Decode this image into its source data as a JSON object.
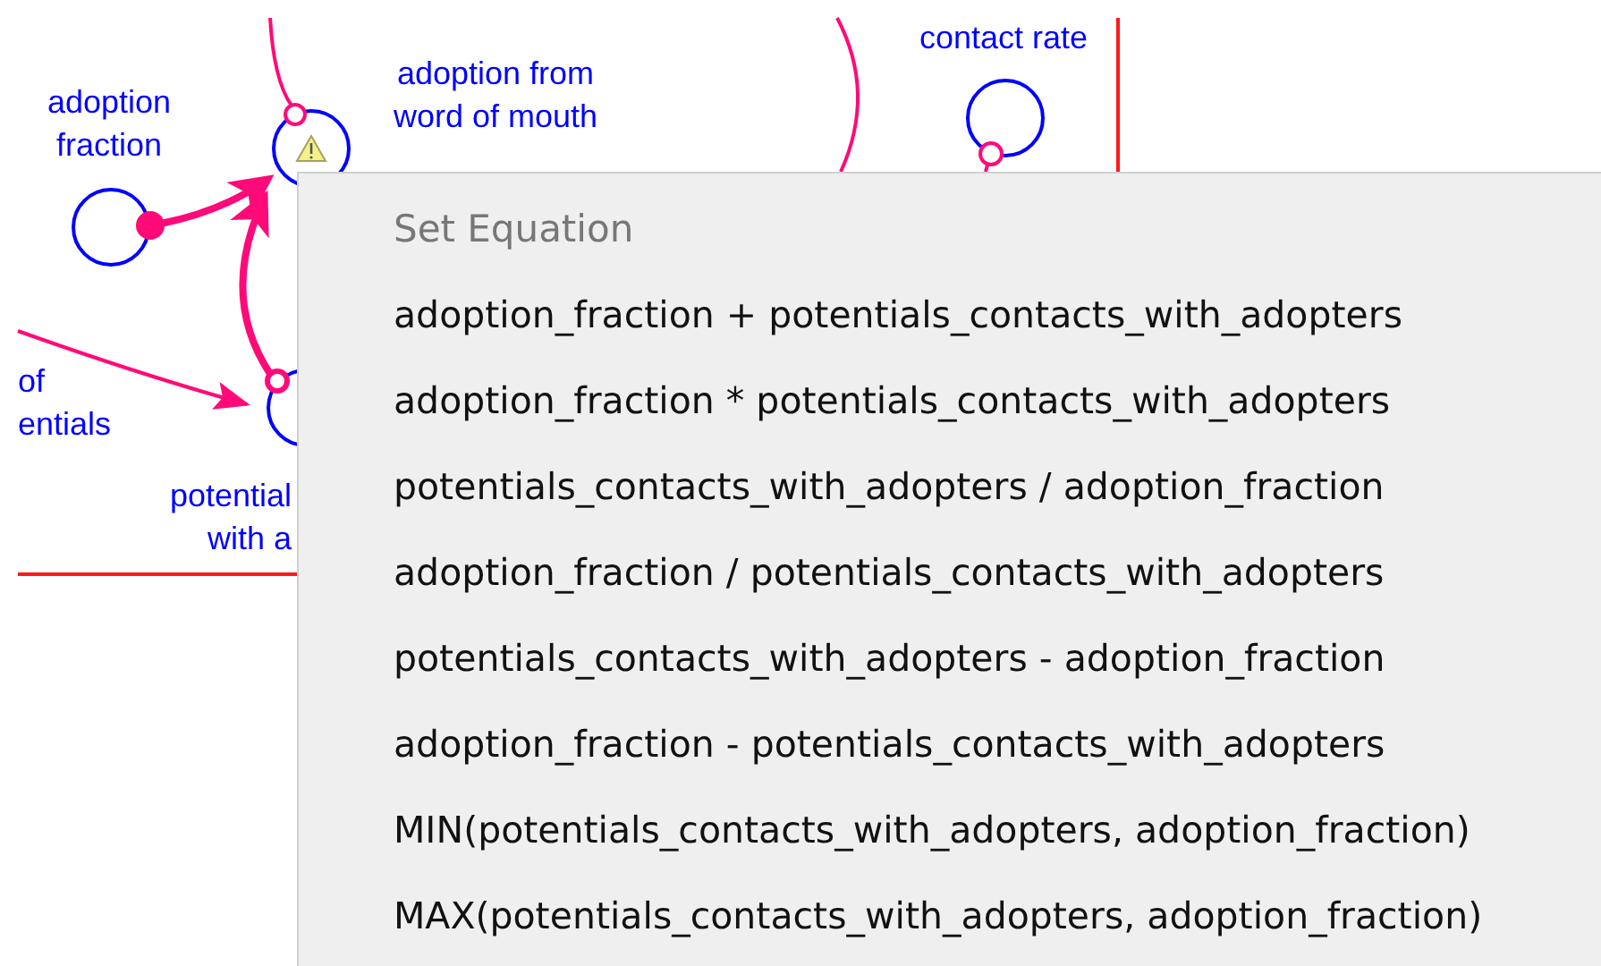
{
  "diagram": {
    "labels": [
      {
        "text": "adoption\nfraction",
        "kind": "center"
      },
      {
        "text": "adoption from\nword of mouth",
        "kind": "center"
      },
      {
        "text": "contact rate",
        "kind": "center"
      },
      {
        "text": "of\nentials",
        "kind": "left"
      },
      {
        "text": "potential\nwith a",
        "kind": "right"
      }
    ]
  },
  "context_menu": {
    "title": "Set Equation",
    "items": [
      "adoption_fraction + potentials_contacts_with_adopters",
      "adoption_fraction * potentials_contacts_with_adopters",
      "potentials_contacts_with_adopters / adoption_fraction",
      "adoption_fraction / potentials_contacts_with_adopters",
      "potentials_contacts_with_adopters - adoption_fraction",
      "adoption_fraction - potentials_contacts_with_adopters",
      "MIN(potentials_contacts_with_adopters, adoption_fraction)",
      "MAX(potentials_contacts_with_adopters, adoption_fraction)"
    ]
  }
}
